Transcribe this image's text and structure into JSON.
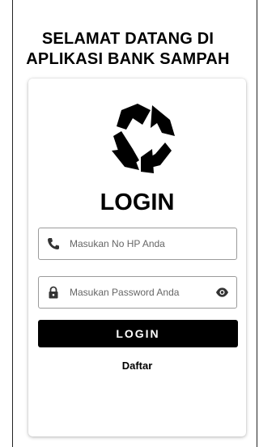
{
  "header": {
    "welcome_line1": "SELAMAT DATANG DI",
    "welcome_line2": "APLIKASI BANK SAMPAH"
  },
  "card": {
    "logo_icon": "recycle-icon",
    "title": "LOGIN",
    "phone_field": {
      "icon": "phone-icon",
      "placeholder": "Masukan No HP Anda",
      "value": ""
    },
    "password_field": {
      "icon": "lock-icon",
      "placeholder": "Masukan Password Anda",
      "value": "",
      "toggle_icon": "eye-icon"
    },
    "login_button_label": "LOGIN",
    "register_link": "Daftar"
  },
  "colors": {
    "button_bg": "#000000",
    "button_text": "#ffffff",
    "field_border": "#9b9b9b"
  }
}
